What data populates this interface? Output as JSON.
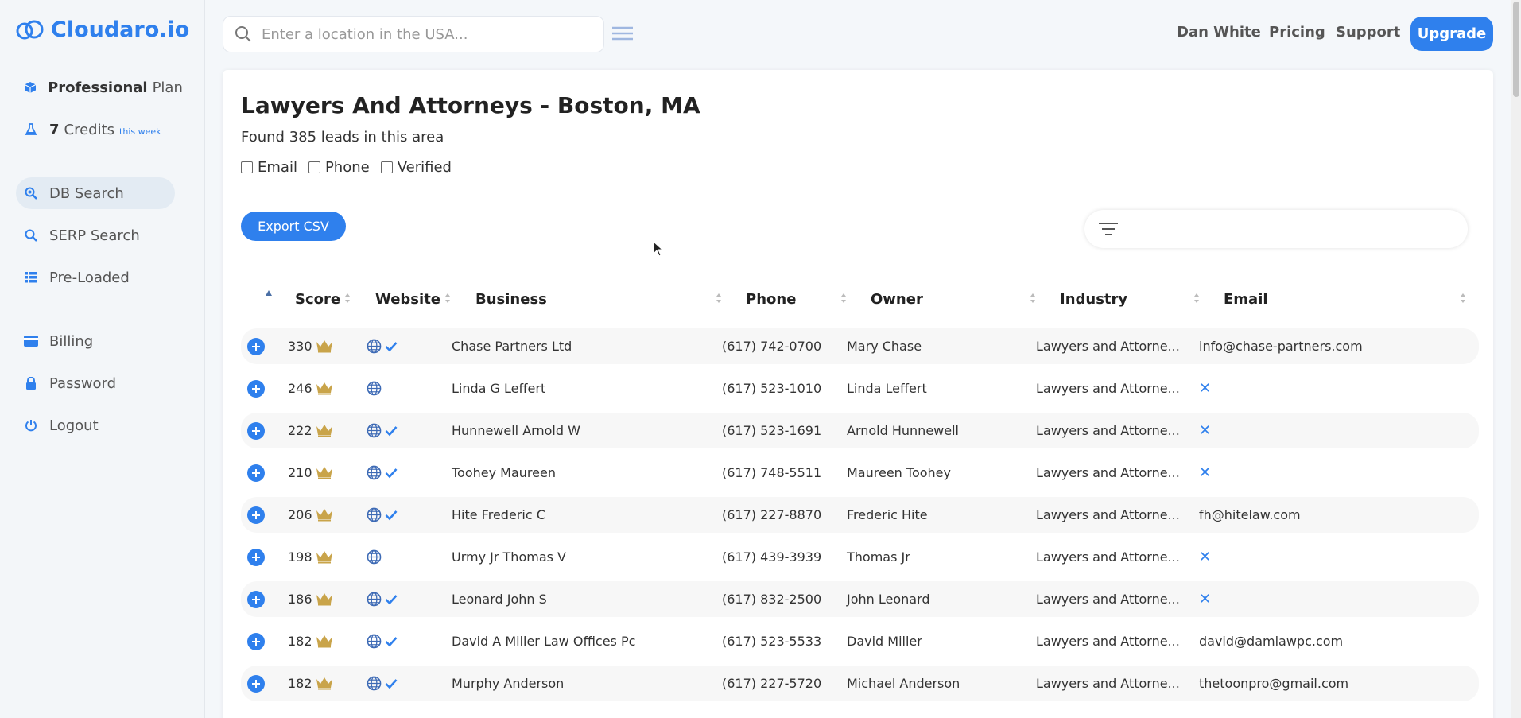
{
  "app": {
    "name": "Cloudaro.io",
    "accent": "#2f80ed"
  },
  "sidebar": {
    "plan_bold": "Professional",
    "plan_rest": "Plan",
    "credits_num": "7",
    "credits_label": "Credits",
    "credits_period": "this week",
    "items": [
      {
        "label": "DB Search",
        "icon": "db-search-icon"
      },
      {
        "label": "SERP Search",
        "icon": "search-icon"
      },
      {
        "label": "Pre-Loaded",
        "icon": "list-icon"
      },
      {
        "label": "Billing",
        "icon": "credit-card-icon"
      },
      {
        "label": "Password",
        "icon": "lock-icon"
      },
      {
        "label": "Logout",
        "icon": "power-icon"
      }
    ]
  },
  "topbar": {
    "search_placeholder": "Enter a location in the USA...",
    "nav": [
      "Dan White",
      "Pricing",
      "Support"
    ],
    "upgrade": "Upgrade"
  },
  "main": {
    "title": "Lawyers And Attorneys - Boston, MA",
    "found": "Found 385 leads in this area",
    "filters": [
      "Email",
      "Phone",
      "Verified"
    ],
    "export": "Export CSV"
  },
  "table": {
    "headers": [
      "Score",
      "Website",
      "Business",
      "Phone",
      "Owner",
      "Industry",
      "Email"
    ],
    "rows": [
      {
        "score": "330",
        "verified": true,
        "business": "Chase Partners Ltd",
        "phone": "(617) 742-0700",
        "owner": "Mary Chase",
        "industry": "Lawyers and Attorne...",
        "email": "info@chase-partners.com"
      },
      {
        "score": "246",
        "verified": false,
        "business": "Linda G Leffert",
        "phone": "(617) 523-1010",
        "owner": "Linda Leffert",
        "industry": "Lawyers and Attorne...",
        "email": ""
      },
      {
        "score": "222",
        "verified": true,
        "business": "Hunnewell Arnold W",
        "phone": "(617) 523-1691",
        "owner": "Arnold Hunnewell",
        "industry": "Lawyers and Attorne...",
        "email": ""
      },
      {
        "score": "210",
        "verified": true,
        "business": "Toohey Maureen",
        "phone": "(617) 748-5511",
        "owner": "Maureen Toohey",
        "industry": "Lawyers and Attorne...",
        "email": ""
      },
      {
        "score": "206",
        "verified": true,
        "business": "Hite Frederic C",
        "phone": "(617) 227-8870",
        "owner": "Frederic Hite",
        "industry": "Lawyers and Attorne...",
        "email": "fh@hitelaw.com"
      },
      {
        "score": "198",
        "verified": false,
        "business": "Urmy Jr Thomas V",
        "phone": "(617) 439-3939",
        "owner": "Thomas Jr",
        "industry": "Lawyers and Attorne...",
        "email": ""
      },
      {
        "score": "186",
        "verified": true,
        "business": "Leonard John S",
        "phone": "(617) 832-2500",
        "owner": "John Leonard",
        "industry": "Lawyers and Attorne...",
        "email": ""
      },
      {
        "score": "182",
        "verified": true,
        "business": "David A Miller Law Offices Pc",
        "phone": "(617) 523-5533",
        "owner": "David Miller",
        "industry": "Lawyers and Attorne...",
        "email": "david@damlawpc.com"
      },
      {
        "score": "182",
        "verified": true,
        "business": "Murphy Anderson",
        "phone": "(617) 227-5720",
        "owner": "Michael Anderson",
        "industry": "Lawyers and Attorne...",
        "email": "thetoonpro@gmail.com"
      }
    ]
  }
}
